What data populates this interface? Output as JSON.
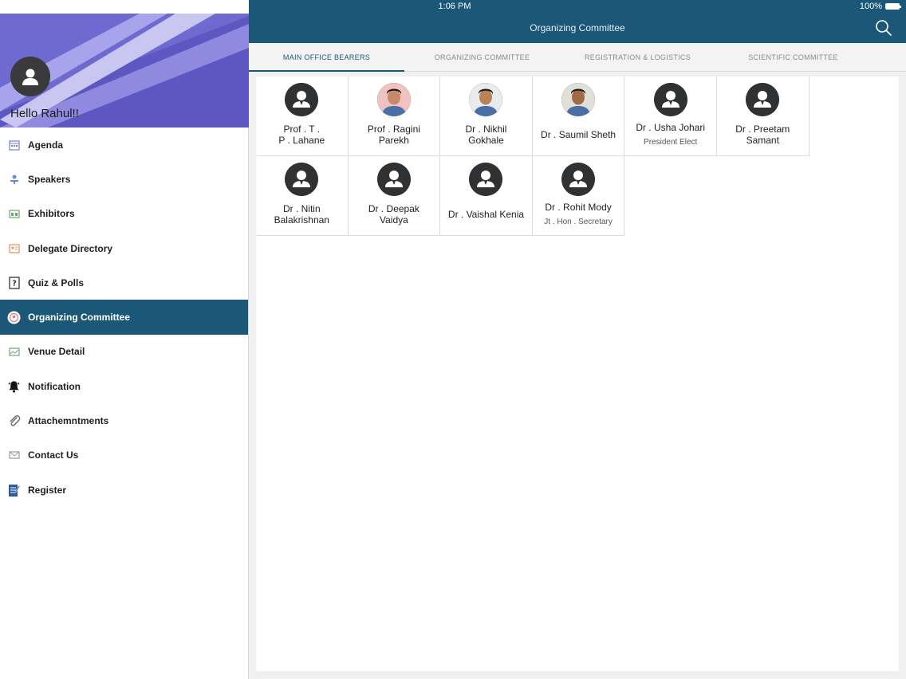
{
  "status_bar": {
    "time": "1:06 PM",
    "battery": "100%"
  },
  "nav": {
    "title": "Organizing Committee",
    "search_icon": "search-icon"
  },
  "sidebar": {
    "greeting": "Hello Rahul!!",
    "items": [
      {
        "label": "Agenda",
        "icon": "calendar-icon",
        "color": "#7a7fc4"
      },
      {
        "label": "Speakers",
        "icon": "speaker-icon",
        "color": "#6a8ad8"
      },
      {
        "label": "Exhibitors",
        "icon": "exhibitor-icon",
        "color": "#6aa86a"
      },
      {
        "label": "Delegate Directory",
        "icon": "directory-icon",
        "color": "#e0905a"
      },
      {
        "label": "Quiz & Polls",
        "icon": "quiz-icon",
        "color": "#333333"
      },
      {
        "label": "Organizing Committee",
        "icon": "committee-icon",
        "color": "#d77b8a",
        "active": true
      },
      {
        "label": "Venue Detail",
        "icon": "venue-icon",
        "color": "#7aa07a"
      },
      {
        "label": "Notification",
        "icon": "bell-icon",
        "color": "#111111"
      },
      {
        "label": "Attachemntments",
        "icon": "paperclip-icon",
        "color": "#666666"
      },
      {
        "label": "Contact Us",
        "icon": "mail-icon",
        "color": "#9a9a9a"
      },
      {
        "label": "Register",
        "icon": "register-icon",
        "color": "#2c5a9e"
      }
    ]
  },
  "tabs": [
    {
      "label": "MAIN OFFICE BEARERS",
      "active": true
    },
    {
      "label": "ORGANIZING COMMITTEE",
      "active": false
    },
    {
      "label": "REGISTRATION & LOGISTICS",
      "active": false
    },
    {
      "label": "SCIENTIFIC COMMITTEE",
      "active": false
    }
  ],
  "members": [
    {
      "name": "Prof . T .\nP . Lahane",
      "role": "",
      "photo": "placeholder"
    },
    {
      "name": "Prof . Ragini\nParekh",
      "role": "",
      "photo": "photo"
    },
    {
      "name": "Dr . Nikhil\nGokhale",
      "role": "",
      "photo": "photo"
    },
    {
      "name": "Dr . Saumil Sheth",
      "role": "",
      "photo": "photo"
    },
    {
      "name": "Dr . Usha Johari",
      "role": "President Elect",
      "photo": "placeholder"
    },
    {
      "name": "Dr . Preetam\nSamant",
      "role": "",
      "photo": "placeholder"
    },
    {
      "name": "Dr . Nitin\nBalakrishnan",
      "role": "",
      "photo": "placeholder"
    },
    {
      "name": "Dr . Deepak\nVaidya",
      "role": "",
      "photo": "placeholder"
    },
    {
      "name": "Dr . Vaishal Kenia",
      "role": "",
      "photo": "placeholder"
    },
    {
      "name": "Dr . Rohit Mody",
      "role": "Jt . Hon . Secretary",
      "photo": "placeholder"
    }
  ],
  "colors": {
    "primary": "#1b5877",
    "header_purple": "#6a64c8"
  }
}
